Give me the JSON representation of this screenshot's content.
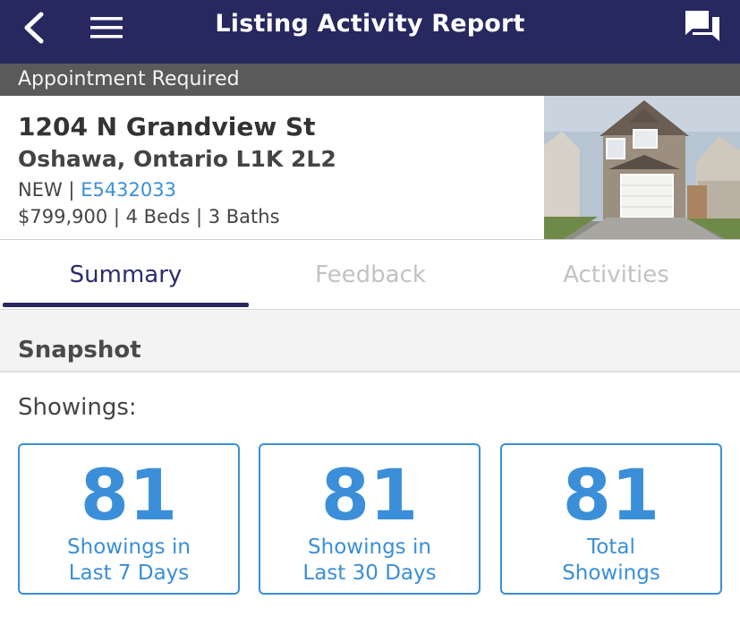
{
  "header": {
    "title": "Listing Activity Report",
    "back_icon": "chevron-left-icon",
    "menu_icon": "hamburger-menu-icon",
    "chat_icon": "chat-bubbles-icon",
    "bg_color": "#27285f"
  },
  "banner": {
    "text": "Appointment Required"
  },
  "listing": {
    "street": "1204 N Grandview St",
    "city": "Oshawa, Ontario L1K 2L2",
    "status": "NEW",
    "separator": " | ",
    "mls": "E5432033",
    "price": "$799,900",
    "beds": "4 Beds",
    "baths": "3 Baths",
    "link_color": "#3b8fd8"
  },
  "tabs": [
    {
      "label": "Summary",
      "active": true
    },
    {
      "label": "Feedback",
      "active": false
    },
    {
      "label": "Activities",
      "active": false
    }
  ],
  "snapshot": {
    "title": "Snapshot",
    "showings_label": "Showings:",
    "cards": [
      {
        "value": "81",
        "line1": "Showings in",
        "line2": "Last 7 Days"
      },
      {
        "value": "81",
        "line1": "Showings in",
        "line2": "Last 30 Days"
      },
      {
        "value": "81",
        "line1": "Total",
        "line2": "Showings"
      }
    ],
    "accent_color": "#3b8fd8"
  }
}
